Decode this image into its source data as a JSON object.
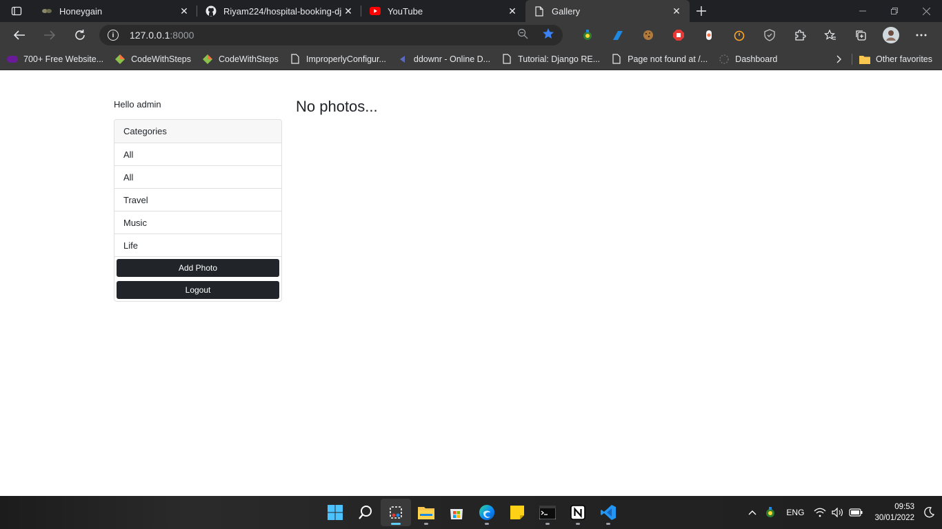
{
  "browser": {
    "tabs": [
      {
        "title": "Honeygain",
        "icon": "honeygain-icon"
      },
      {
        "title": "Riyam224/hospital-booking-dj",
        "icon": "github-icon"
      },
      {
        "title": "YouTube",
        "icon": "youtube-icon"
      },
      {
        "title": "Gallery",
        "icon": "page-icon",
        "active": true
      }
    ],
    "url_host": "127.0.0.1",
    "url_port": ":8000",
    "bookmarks": [
      {
        "label": "700+ Free Website...",
        "icon": "colorlib-icon"
      },
      {
        "label": "CodeWithSteps",
        "icon": "codewithsteps-icon"
      },
      {
        "label": "CodeWithSteps",
        "icon": "codewithsteps-icon"
      },
      {
        "label": "ImproperlyConfigur...",
        "icon": "page-icon"
      },
      {
        "label": "ddownr - Online D...",
        "icon": "ddownr-icon"
      },
      {
        "label": "Tutorial: Django RE...",
        "icon": "page-icon"
      },
      {
        "label": "Page not found at /...",
        "icon": "page-icon"
      },
      {
        "label": "Dashboard",
        "icon": "dashboard-icon"
      }
    ],
    "other_favorites": "Other favorites",
    "accent": "#3b82f6"
  },
  "page": {
    "greeting": "Hello admin",
    "categories_header": "Categories",
    "categories": [
      "All",
      "All",
      "Travel",
      "Music",
      "Life"
    ],
    "add_photo": "Add Photo",
    "logout": "Logout",
    "message": "No photos..."
  },
  "taskbar": {
    "lang": "ENG",
    "time": "09:53",
    "date": "30/01/2022",
    "apps": [
      "start",
      "search",
      "snipping-tool",
      "file-explorer",
      "microsoft-store",
      "edge",
      "sticky-notes",
      "terminal",
      "notion",
      "vscode"
    ]
  }
}
